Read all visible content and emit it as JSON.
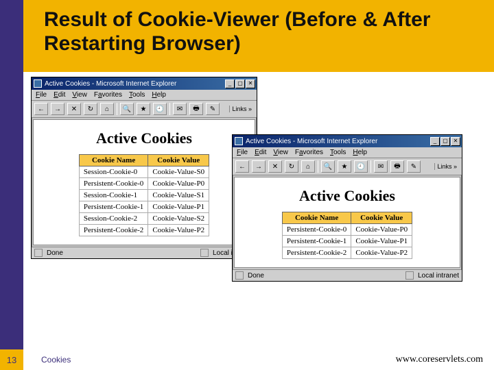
{
  "slide": {
    "title": "Result of Cookie-Viewer (Before & After Restarting Browser)",
    "page_number": "13",
    "footer_label": "Cookies",
    "footer_url": "www.coreservlets.com"
  },
  "windowA": {
    "title": "Active Cookies - Microsoft Internet Explorer",
    "menus": {
      "file": "File",
      "edit": "Edit",
      "view": "View",
      "fav": "Favorites",
      "tools": "Tools",
      "help": "Help"
    },
    "links_label": "Links",
    "heading": "Active Cookies",
    "cols": {
      "name": "Cookie Name",
      "value": "Cookie Value"
    },
    "rows": [
      {
        "n": "Session-Cookie-0",
        "v": "Cookie-Value-S0"
      },
      {
        "n": "Persistent-Cookie-0",
        "v": "Cookie-Value-P0"
      },
      {
        "n": "Session-Cookie-1",
        "v": "Cookie-Value-S1"
      },
      {
        "n": "Persistent-Cookie-1",
        "v": "Cookie-Value-P1"
      },
      {
        "n": "Session-Cookie-2",
        "v": "Cookie-Value-S2"
      },
      {
        "n": "Persistent-Cookie-2",
        "v": "Cookie-Value-P2"
      }
    ],
    "status_left": "Done",
    "status_right": "Local intranet"
  },
  "windowB": {
    "title": "Active Cookies - Microsoft Internet Explorer",
    "menus": {
      "file": "File",
      "edit": "Edit",
      "view": "View",
      "fav": "Favorites",
      "tools": "Tools",
      "help": "Help"
    },
    "links_label": "Links",
    "heading": "Active Cookies",
    "cols": {
      "name": "Cookie Name",
      "value": "Cookie Value"
    },
    "rows": [
      {
        "n": "Persistent-Cookie-0",
        "v": "Cookie-Value-P0"
      },
      {
        "n": "Persistent-Cookie-1",
        "v": "Cookie-Value-P1"
      },
      {
        "n": "Persistent-Cookie-2",
        "v": "Cookie-Value-P2"
      }
    ],
    "status_left": "Done",
    "status_right": "Local intranet"
  },
  "icons": {
    "back": "←",
    "fwd": "→",
    "stop": "✕",
    "refresh": "↻",
    "home": "⌂",
    "search": "🔍",
    "fav": "★",
    "history": "🕘",
    "mail": "✉",
    "print": "🖶",
    "edit": "✎"
  }
}
